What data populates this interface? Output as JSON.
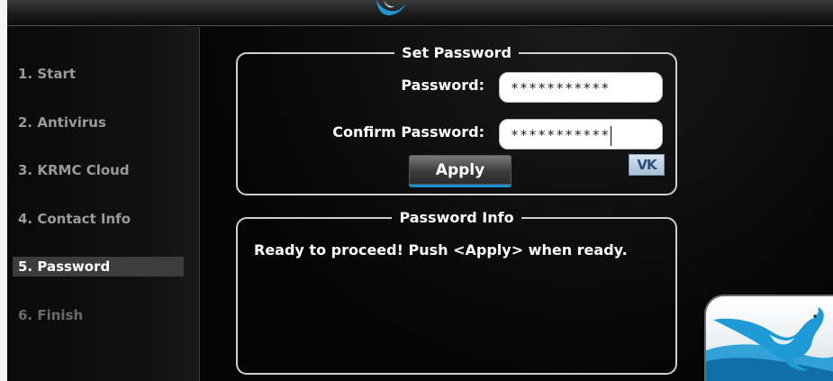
{
  "sidebar": {
    "items": [
      {
        "label": "1. Start",
        "state": "normal"
      },
      {
        "label": "2. Antivirus",
        "state": "normal"
      },
      {
        "label": "3. KRMC Cloud",
        "state": "normal"
      },
      {
        "label": "4. Contact Info",
        "state": "normal"
      },
      {
        "label": "5. Password",
        "state": "active"
      },
      {
        "label": "6. Finish",
        "state": "disabled"
      }
    ]
  },
  "set_password": {
    "legend": "Set Password",
    "password_label": "Password:",
    "password_value": "***********",
    "confirm_label": "Confirm Password:",
    "confirm_value": "***********",
    "apply_label": "Apply",
    "vk_label": "VK"
  },
  "password_info": {
    "legend": "Password Info",
    "message": "Ready to proceed! Push <Apply> when ready."
  },
  "colors": {
    "accent": "#1c8fcf",
    "logo_blue": "#1e9ad6"
  }
}
